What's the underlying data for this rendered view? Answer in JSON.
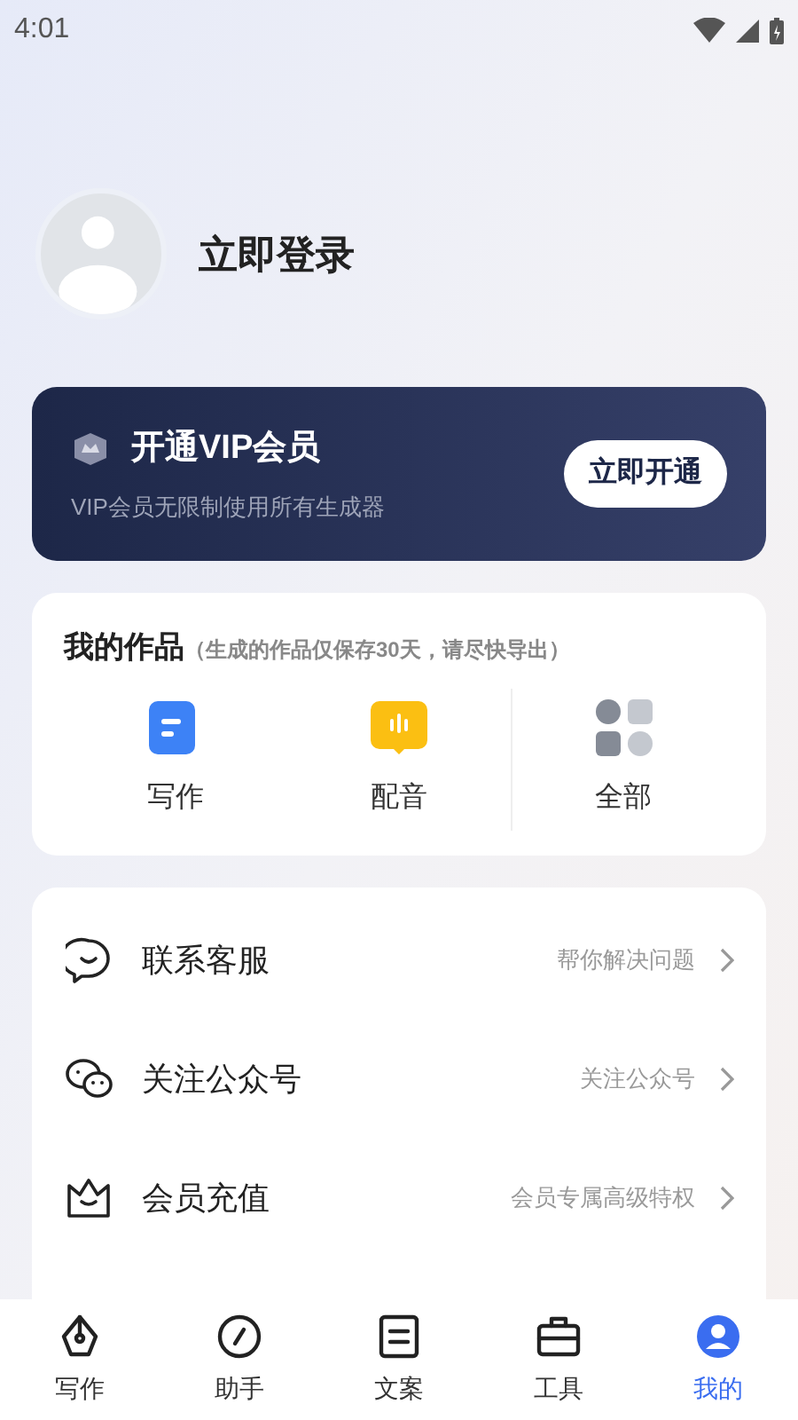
{
  "status_bar": {
    "time": "4:01"
  },
  "profile": {
    "name": "立即登录"
  },
  "vip": {
    "title": "开通VIP会员",
    "subtitle": "VIP会员无限制使用所有生成器",
    "button": "立即开通"
  },
  "works": {
    "title": "我的作品",
    "note": "（生成的作品仅保存30天，请尽快导出）",
    "items": [
      {
        "kind": "writing",
        "label": "写作"
      },
      {
        "kind": "dubbing",
        "label": "配音"
      },
      {
        "kind": "all",
        "label": "全部"
      }
    ]
  },
  "menu": [
    {
      "kind": "service",
      "label": "联系客服",
      "hint": "帮你解决问题"
    },
    {
      "kind": "wechat",
      "label": "关注公众号",
      "hint": "关注公众号"
    },
    {
      "kind": "vip",
      "label": "会员充值",
      "hint": "会员专属高级特权"
    }
  ],
  "tabs": [
    {
      "kind": "pen",
      "label": "写作",
      "selected": false
    },
    {
      "kind": "compass",
      "label": "助手",
      "selected": false
    },
    {
      "kind": "doc",
      "label": "文案",
      "selected": false
    },
    {
      "kind": "tool",
      "label": "工具",
      "selected": false
    },
    {
      "kind": "me",
      "label": "我的",
      "selected": true
    }
  ]
}
